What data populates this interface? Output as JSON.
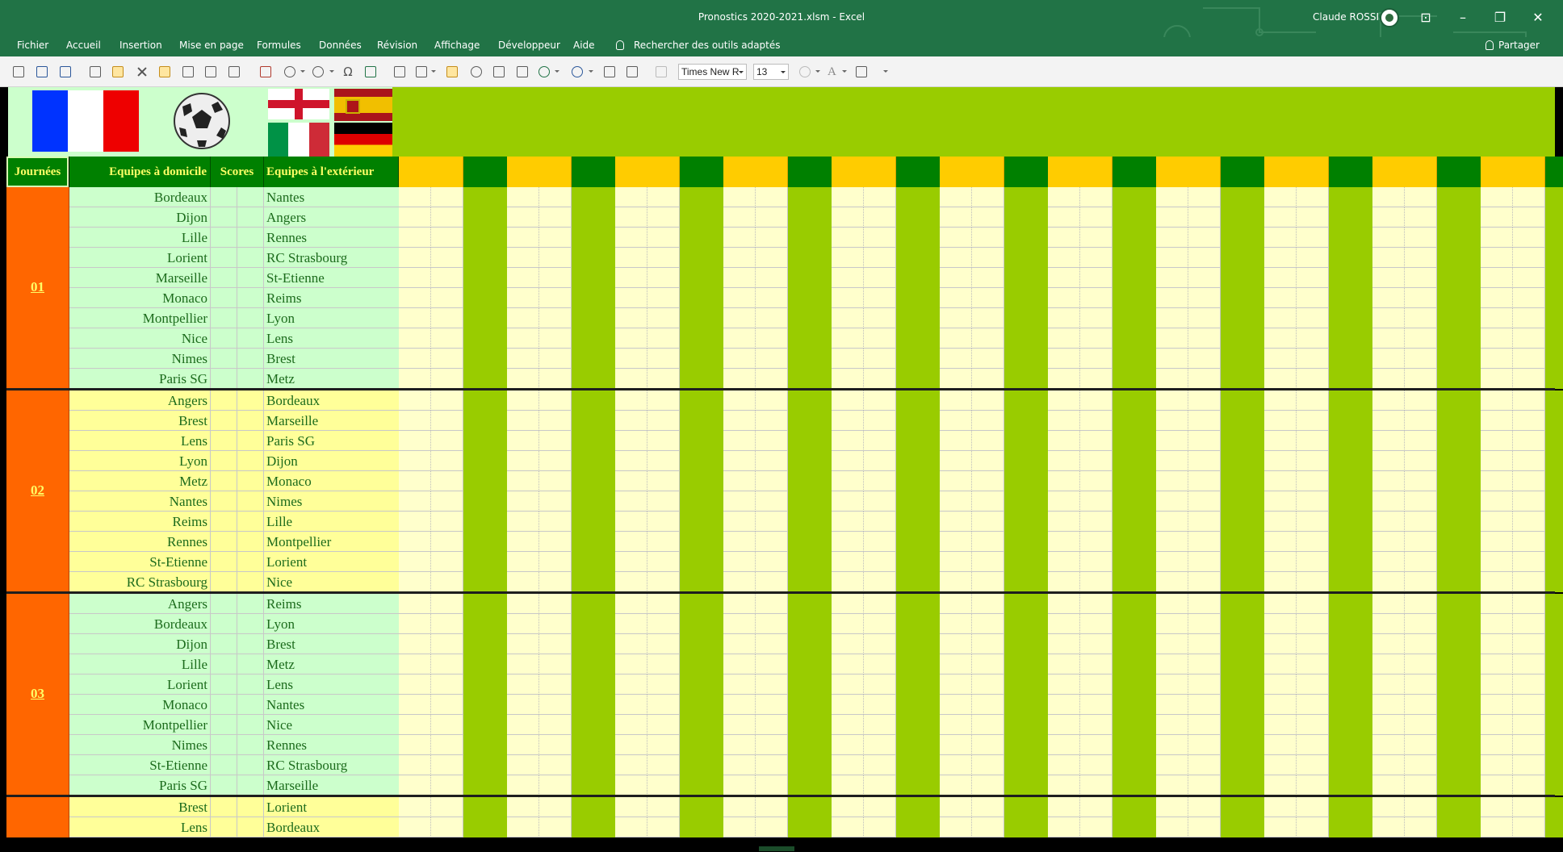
{
  "window": {
    "title": "Pronostics 2020-2021.xlsm  -  Excel",
    "user": "Claude ROSSI"
  },
  "menu": {
    "items": [
      "Fichier",
      "Accueil",
      "Insertion",
      "Mise en page",
      "Formules",
      "Données",
      "Révision",
      "Affichage",
      "Développeur",
      "Aide"
    ],
    "search_label": "Rechercher des outils adaptés",
    "share_label": "Partager"
  },
  "toolbar": {
    "font_name": "Times New R",
    "font_size": "13"
  },
  "colors": {
    "excel_green": "#217346",
    "header_green": "#008000",
    "header_text": "#ffff66",
    "day_orange": "#ff6600",
    "mint": "#ccffcc",
    "pale_yellow": "#ffff99",
    "light_yellow": "#ffffcc",
    "lime": "#99cc00",
    "gold": "#ffcc00"
  },
  "headers": {
    "journees": "Journées",
    "home": "Equipes à domicile",
    "scores": "Scores",
    "away": "Equipes à l'extérieur"
  },
  "rounds": [
    {
      "label": "01",
      "matches": [
        {
          "home": "Bordeaux",
          "away": "Nantes"
        },
        {
          "home": "Dijon",
          "away": "Angers"
        },
        {
          "home": "Lille",
          "away": "Rennes"
        },
        {
          "home": "Lorient",
          "away": "RC Strasbourg"
        },
        {
          "home": "Marseille",
          "away": "St-Etienne"
        },
        {
          "home": "Monaco",
          "away": "Reims"
        },
        {
          "home": "Montpellier",
          "away": "Lyon"
        },
        {
          "home": "Nice",
          "away": "Lens"
        },
        {
          "home": "Nimes",
          "away": "Brest"
        },
        {
          "home": "Paris SG",
          "away": "Metz"
        }
      ]
    },
    {
      "label": "02",
      "matches": [
        {
          "home": "Angers",
          "away": "Bordeaux"
        },
        {
          "home": "Brest",
          "away": "Marseille"
        },
        {
          "home": "Lens",
          "away": "Paris SG"
        },
        {
          "home": "Lyon",
          "away": "Dijon"
        },
        {
          "home": "Metz",
          "away": "Monaco"
        },
        {
          "home": "Nantes",
          "away": "Nimes"
        },
        {
          "home": "Reims",
          "away": "Lille"
        },
        {
          "home": "Rennes",
          "away": "Montpellier"
        },
        {
          "home": "St-Etienne",
          "away": "Lorient"
        },
        {
          "home": "RC Strasbourg",
          "away": "Nice"
        }
      ]
    },
    {
      "label": "03",
      "matches": [
        {
          "home": "Angers",
          "away": "Reims"
        },
        {
          "home": "Bordeaux",
          "away": "Lyon"
        },
        {
          "home": "Dijon",
          "away": "Brest"
        },
        {
          "home": "Lille",
          "away": "Metz"
        },
        {
          "home": "Lorient",
          "away": "Lens"
        },
        {
          "home": "Monaco",
          "away": "Nantes"
        },
        {
          "home": "Montpellier",
          "away": "Nice"
        },
        {
          "home": "Nimes",
          "away": "Rennes"
        },
        {
          "home": "St-Etienne",
          "away": "RC Strasbourg"
        },
        {
          "home": "Paris SG",
          "away": "Marseille"
        }
      ]
    },
    {
      "label": "",
      "matches": [
        {
          "home": "Brest",
          "away": "Lorient"
        },
        {
          "home": "Lens",
          "away": "Bordeaux"
        }
      ]
    }
  ]
}
